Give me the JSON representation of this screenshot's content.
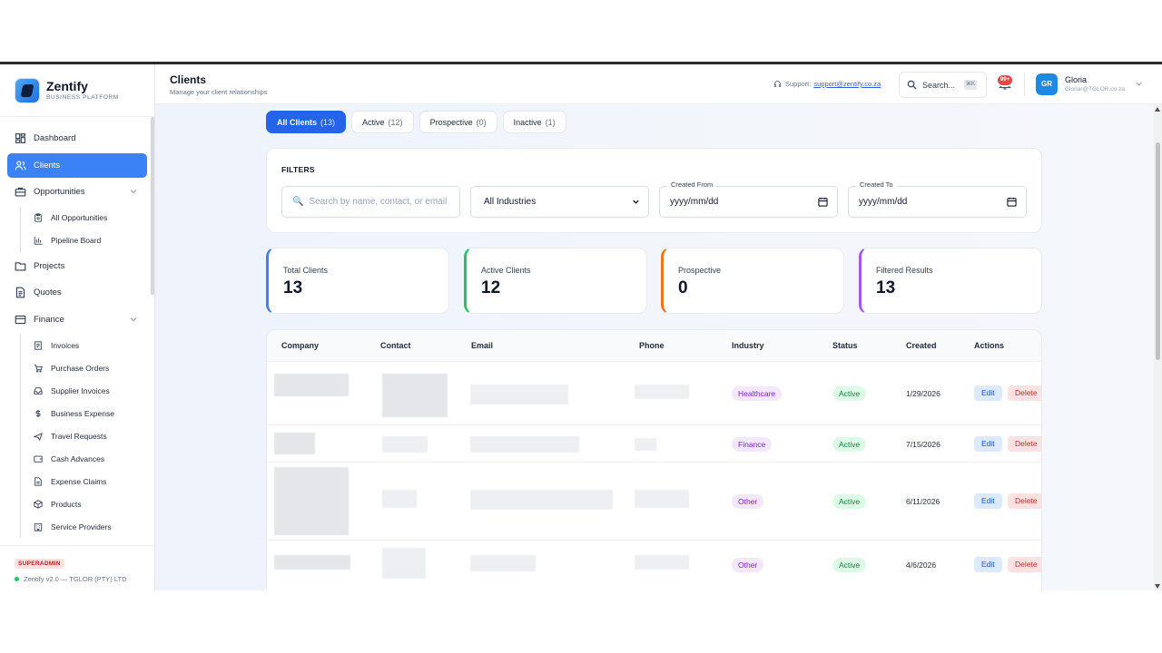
{
  "app": {
    "name": "Zentify",
    "tagline": "BUSINESS PLATFORM"
  },
  "sidebar": {
    "items": [
      {
        "label": "Dashboard",
        "icon": "dashboard-icon"
      },
      {
        "label": "Clients",
        "icon": "users-icon",
        "active": true
      },
      {
        "label": "Opportunities",
        "icon": "briefcase-icon",
        "expanded": true,
        "children": [
          {
            "label": "All Opportunities",
            "icon": "clipboard-icon"
          },
          {
            "label": "Pipeline Board",
            "icon": "bar-chart-icon"
          }
        ]
      },
      {
        "label": "Projects",
        "icon": "folder-icon"
      },
      {
        "label": "Quotes",
        "icon": "document-icon"
      },
      {
        "label": "Finance",
        "icon": "wallet-icon",
        "expanded": true,
        "children": [
          {
            "label": "Invoices",
            "icon": "receipt-icon"
          },
          {
            "label": "Purchase Orders",
            "icon": "cart-icon"
          },
          {
            "label": "Supplier Invoices",
            "icon": "inbox-icon"
          },
          {
            "label": "Business Expense",
            "icon": "dollar-icon"
          },
          {
            "label": "Travel Requests",
            "icon": "plane-icon"
          },
          {
            "label": "Cash Advances",
            "icon": "wallet-icon"
          },
          {
            "label": "Expense Claims",
            "icon": "file-icon"
          },
          {
            "label": "Products",
            "icon": "box-icon"
          },
          {
            "label": "Service Providers",
            "icon": "building-icon"
          }
        ]
      }
    ],
    "footer": {
      "role": "SUPERADMIN",
      "version": "Zentify v2.0 — TGLOR (PTY) LTD"
    }
  },
  "header": {
    "title": "Clients",
    "subtitle": "Manage your client relationships",
    "support_label": "Support:",
    "support_email": "support@zentify.co.za",
    "search_label": "Search...",
    "search_shortcut": "⌘K",
    "notifications": "99+",
    "user": {
      "initials": "GR",
      "name": "Gloria",
      "email": "Gloriar@TGLOR.co.za"
    }
  },
  "tabs": [
    {
      "label": "All Clients",
      "count": "(13)",
      "active": true
    },
    {
      "label": "Active",
      "count": "(12)"
    },
    {
      "label": "Prospective",
      "count": "(0)"
    },
    {
      "label": "Inactive",
      "count": "(1)"
    }
  ],
  "filters": {
    "title": "FILTERS",
    "search_placeholder": "Search by name, contact, or email",
    "industry_selected": "All Industries",
    "created_from_label": "Created From",
    "created_to_label": "Created To",
    "date_placeholder": "yyyy/mm/dd"
  },
  "stats": [
    {
      "label": "Total Clients",
      "value": "13",
      "color": "#3b82f6"
    },
    {
      "label": "Active Clients",
      "value": "12",
      "color": "#22c55e"
    },
    {
      "label": "Prospective",
      "value": "0",
      "color": "#f97316"
    },
    {
      "label": "Filtered Results",
      "value": "13",
      "color": "#a855f7"
    }
  ],
  "table": {
    "columns": [
      "Company",
      "Contact",
      "Email",
      "Phone",
      "Industry",
      "Status",
      "Created",
      "Actions"
    ],
    "rows": [
      {
        "industry": "Healthcare",
        "status": "Active",
        "created": "1/29/2026"
      },
      {
        "industry": "Finance",
        "status": "Active",
        "created": "7/15/2026"
      },
      {
        "industry": "Other",
        "status": "Active",
        "created": "6/11/2026"
      },
      {
        "industry": "Other",
        "status": "Active",
        "created": "4/6/2026"
      }
    ],
    "edit_label": "Edit",
    "delete_label": "Delete"
  }
}
